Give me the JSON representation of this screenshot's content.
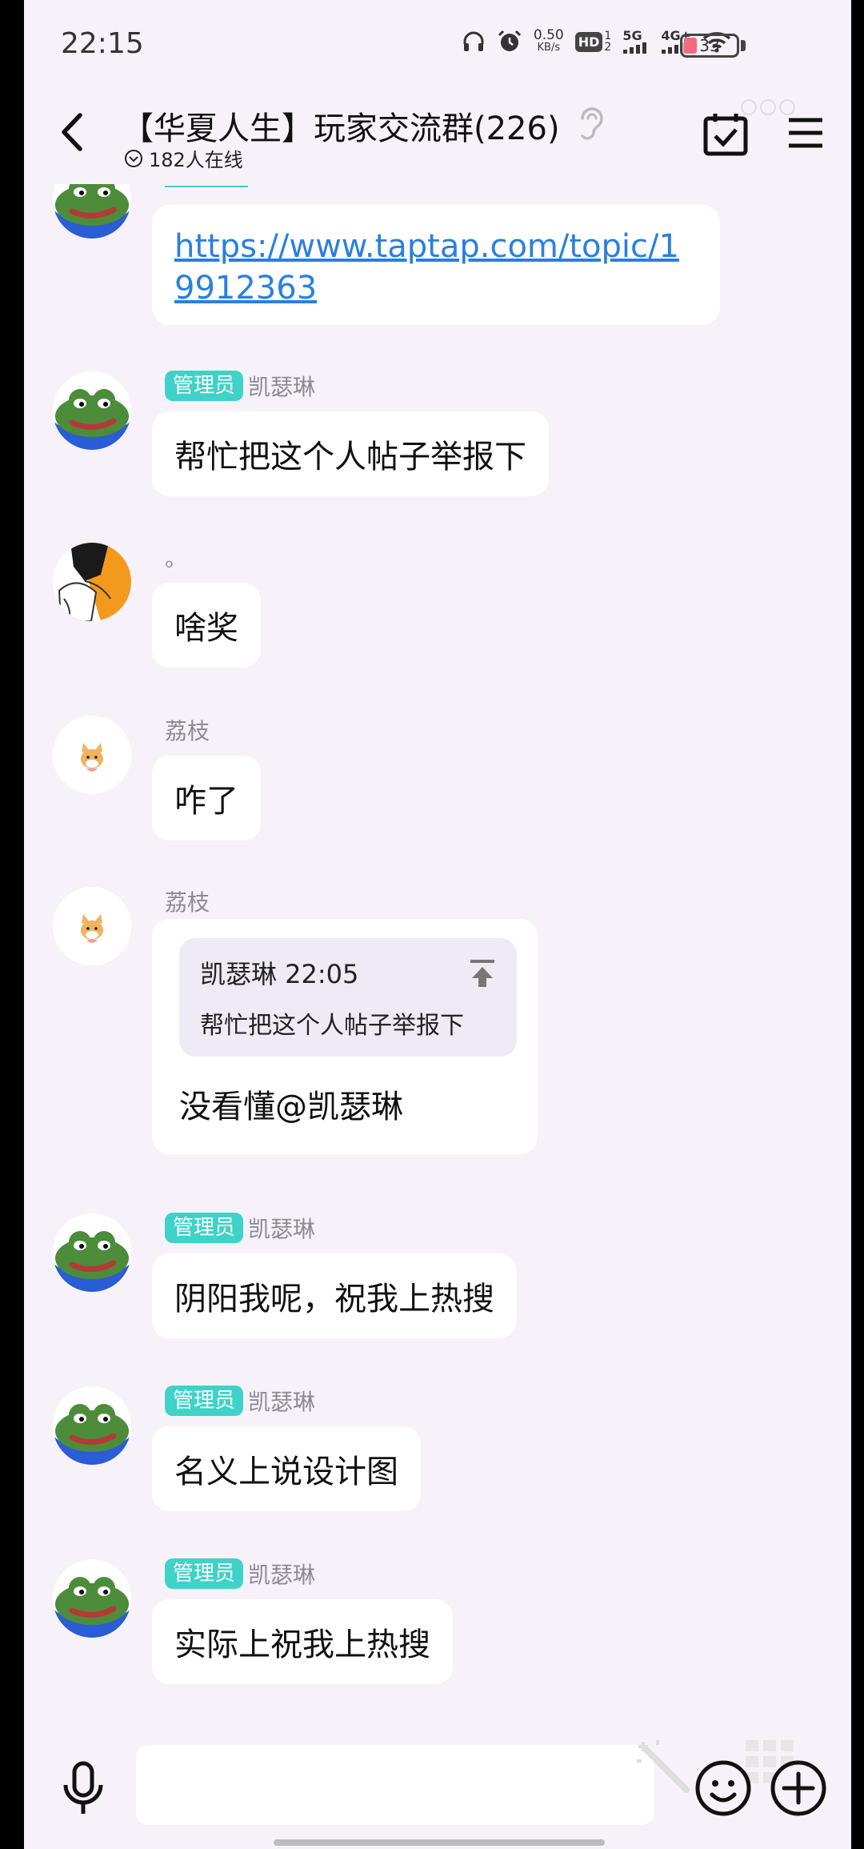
{
  "status_bar": {
    "time": "22:15",
    "net_speed_value": "0.50",
    "net_speed_unit": "KB/s",
    "hd": "HD",
    "sim1": "1",
    "sim2": "2",
    "signal_5g": "5G",
    "signal_4g": "4G+",
    "battery": "33"
  },
  "header": {
    "title": "【华夏人生】玩家交流群(226)",
    "online": "182人在线"
  },
  "messages": [
    {
      "type": "link",
      "text": "https://www.taptap.com/topic/19912363"
    },
    {
      "badge": "管理员",
      "sender": "凯瑟琳",
      "text": "帮忙把这个人帖子举报下"
    },
    {
      "sender": "。",
      "text": "啥奖"
    },
    {
      "sender": "荔枝",
      "text": "咋了"
    },
    {
      "sender": "荔枝",
      "quote_header": "凯瑟琳 22:05",
      "quote_text": "帮忙把这个人帖子举报下",
      "text": "没看懂@凯瑟琳"
    },
    {
      "badge": "管理员",
      "sender": "凯瑟琳",
      "text": "阴阳我呢，祝我上热搜"
    },
    {
      "badge": "管理员",
      "sender": "凯瑟琳",
      "text": "名义上说设计图"
    },
    {
      "badge": "管理员",
      "sender": "凯瑟琳",
      "text": "实际上祝我上热搜"
    }
  ],
  "input": {
    "value": "",
    "placeholder": ""
  },
  "icons": {
    "back": "chevron-left-icon",
    "ear": "ear-icon",
    "calendar": "calendar-check-icon",
    "menu": "menu-icon",
    "mic": "mic-icon",
    "emoji": "smile-icon",
    "plus": "plus-icon"
  },
  "colors": {
    "admin_badge": "#3ed2c8",
    "link": "#2b7fe0",
    "background": "#f7f2f9"
  }
}
